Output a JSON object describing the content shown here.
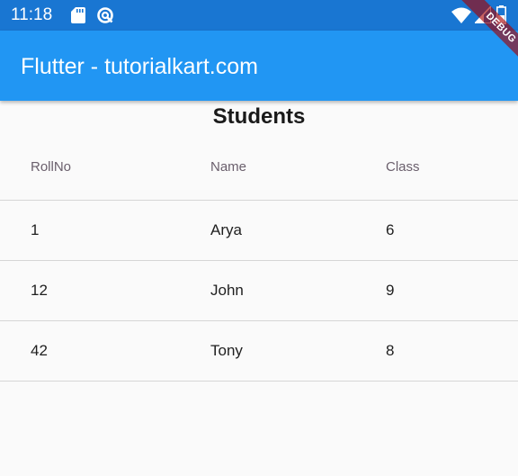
{
  "status_bar": {
    "time": "11:18",
    "left_icons": [
      "sd-card-icon",
      "sync-icon"
    ],
    "right_icons": [
      "wifi-icon",
      "signal-icon",
      "battery-icon"
    ]
  },
  "app_bar": {
    "title": "Flutter - tutorialkart.com",
    "debug_label": "DEBUG"
  },
  "page": {
    "title": "Students"
  },
  "table": {
    "columns": [
      "RollNo",
      "Name",
      "Class"
    ],
    "rows": [
      [
        "1",
        "Arya",
        "6"
      ],
      [
        "12",
        "John",
        "9"
      ],
      [
        "42",
        "Tony",
        "8"
      ]
    ]
  },
  "colors": {
    "status_bar": "#1976d2",
    "app_bar": "#2196f3",
    "background": "#fafafa",
    "header_text": "#6a5f6c",
    "body_text": "#1f1f1f",
    "divider": "#d6d6d6",
    "debug_ribbon": "#a60000"
  }
}
